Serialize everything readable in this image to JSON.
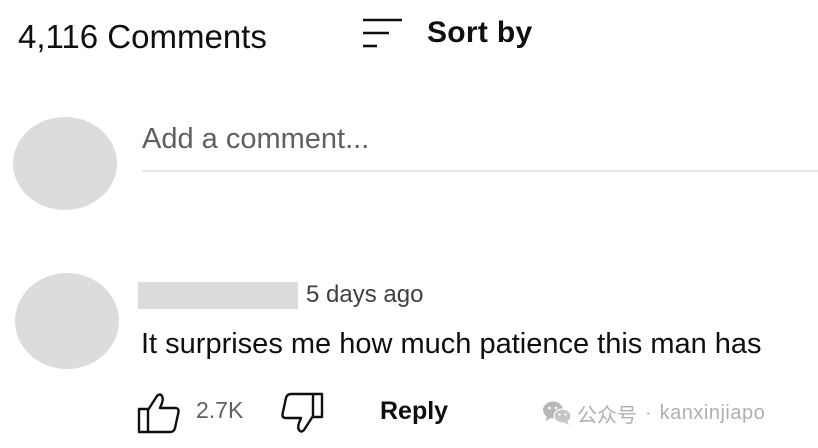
{
  "header": {
    "comments_count": "4,116 Comments",
    "sort_label": "Sort by",
    "sort_icon": "sort-lines-icon"
  },
  "add_comment": {
    "placeholder": "Add a comment..."
  },
  "comment": {
    "timestamp": "5 days ago",
    "text": "It surprises me how much patience this man has",
    "like_count": "2.7K",
    "reply_label": "Reply",
    "like_icon": "thumbs-up-icon",
    "dislike_icon": "thumbs-down-icon"
  },
  "watermark": {
    "account_label": "公众号",
    "separator": "·",
    "handle": "kanxinjiapo",
    "icon": "wechat-icon"
  },
  "colors": {
    "text_primary": "#0f0f0f",
    "text_secondary": "#606060",
    "placeholder_gray": "#dcdcdc",
    "divider": "#e5e5e5",
    "watermark_gray": "#b0b0b0"
  }
}
